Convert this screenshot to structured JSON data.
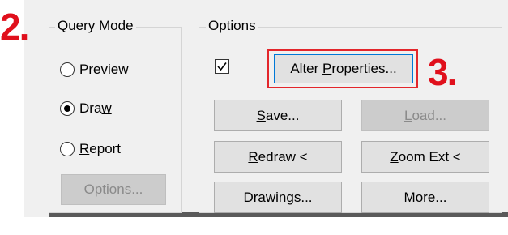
{
  "query_mode": {
    "title": "Query Mode",
    "options": [
      {
        "pre": "",
        "acc": "P",
        "post": "review",
        "checked": false
      },
      {
        "pre": "Dra",
        "acc": "w",
        "post": "",
        "checked": true
      },
      {
        "pre": "",
        "acc": "R",
        "post": "eport",
        "checked": false
      }
    ],
    "options_button": "Options..."
  },
  "options_group": {
    "title": "Options",
    "checkbox_checked": true,
    "alter_properties": {
      "pre": "Alter ",
      "acc": "P",
      "post": "roperties..."
    },
    "save": {
      "pre": "",
      "acc": "S",
      "post": "ave..."
    },
    "load": {
      "pre": "",
      "acc": "L",
      "post": "oad..."
    },
    "redraw": {
      "pre": "",
      "acc": "R",
      "post": "edraw <"
    },
    "zoom_ext": {
      "pre": "",
      "acc": "Z",
      "post": "oom Ext <"
    },
    "drawings": {
      "pre": "",
      "acc": "D",
      "post": "rawings..."
    },
    "more": {
      "pre": "",
      "acc": "M",
      "post": "ore..."
    }
  },
  "callouts": {
    "step2": "2.",
    "step3": "3."
  },
  "colors": {
    "callout": "#e0101c",
    "dialog_bg": "#f0f0f0",
    "button_bg": "#e1e1e1"
  }
}
